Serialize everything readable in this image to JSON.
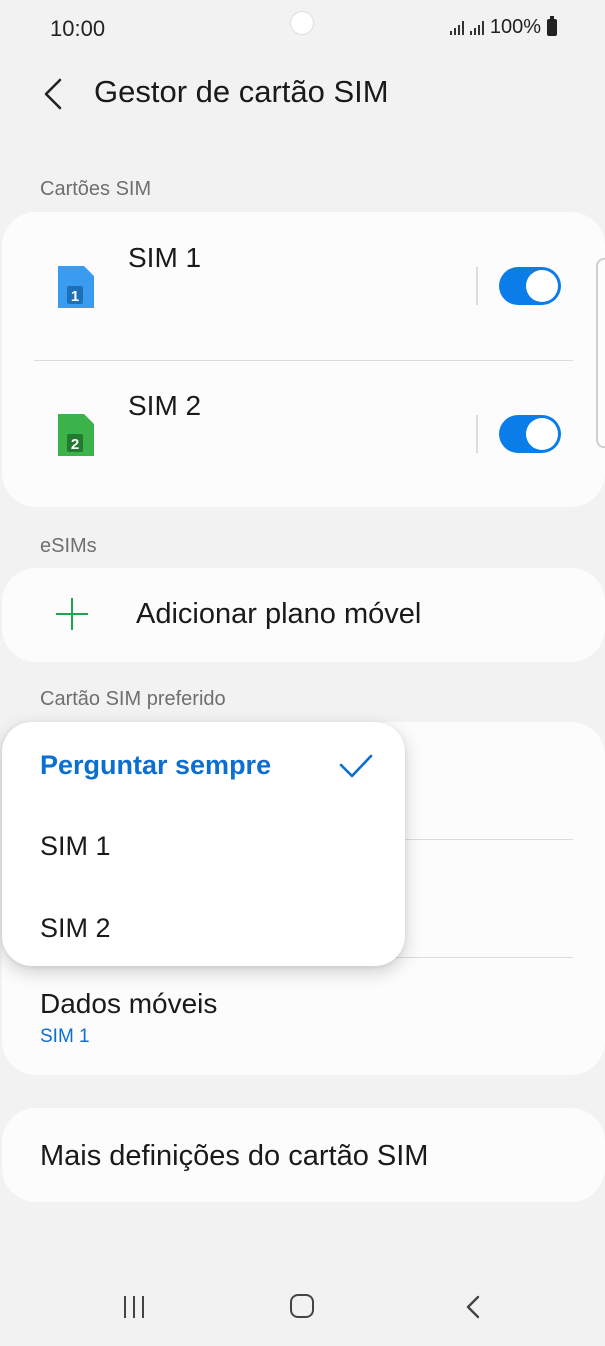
{
  "status_bar": {
    "time": "10:00",
    "battery": "100%"
  },
  "header": {
    "title": "Gestor de cartão SIM",
    "back_icon": "chevron-left-icon"
  },
  "sim_cards": {
    "section_label": "Cartões SIM",
    "items": [
      {
        "name": "SIM 1",
        "badge": "1",
        "color": "#3a9cf0",
        "enabled": true
      },
      {
        "name": "SIM 2",
        "badge": "2",
        "color": "#3cb24a",
        "enabled": true
      }
    ]
  },
  "esims": {
    "section_label": "eSIMs",
    "add_label": "Adicionar plano móvel"
  },
  "preferred": {
    "section_label": "Cartão SIM preferido",
    "mobile_data": {
      "title": "Dados móveis",
      "value": "SIM 1"
    }
  },
  "dropdown": {
    "options": [
      {
        "label": "Perguntar sempre",
        "selected": true
      },
      {
        "label": "SIM 1",
        "selected": false
      },
      {
        "label": "SIM 2",
        "selected": false
      }
    ]
  },
  "more_settings": {
    "label": "Mais definições do cartão SIM"
  },
  "colors": {
    "accent": "#0b6ed1",
    "toggle_on": "#0a7de8",
    "plus": "#1fa64b"
  }
}
